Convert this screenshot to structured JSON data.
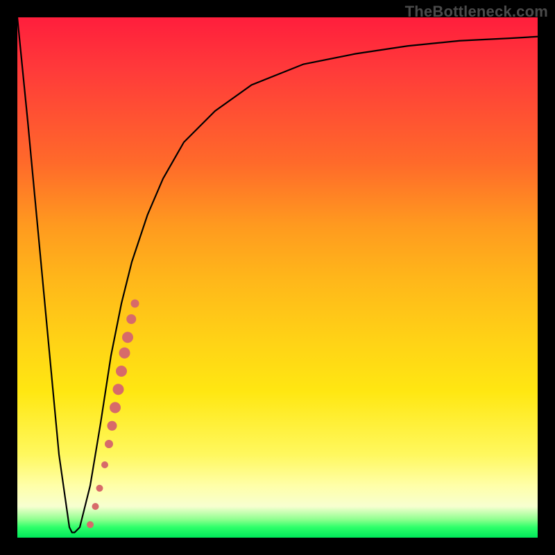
{
  "watermark": {
    "text": "TheBottleneck.com"
  },
  "chart_data": {
    "type": "line",
    "title": "",
    "xlabel": "",
    "ylabel": "",
    "xlim": [
      0,
      100
    ],
    "ylim": [
      0,
      100
    ],
    "series": [
      {
        "name": "bottleneck-curve",
        "x": [
          0,
          2,
          5,
          8,
          10,
          10.5,
          11,
          12,
          14,
          16,
          18,
          20,
          22,
          25,
          28,
          32,
          38,
          45,
          55,
          65,
          75,
          85,
          95,
          100
        ],
        "values": [
          100,
          80,
          48,
          16,
          2,
          1,
          1,
          2,
          10,
          22,
          35,
          45,
          53,
          62,
          69,
          76,
          82,
          87,
          91,
          93,
          94.5,
          95.5,
          96,
          96.3
        ]
      }
    ],
    "markers": [
      {
        "name": "highlight-segment",
        "color": "#d76a6a",
        "points": [
          {
            "x": 14.0,
            "y": 2.5,
            "r": 5
          },
          {
            "x": 15.0,
            "y": 6.0,
            "r": 5
          },
          {
            "x": 15.8,
            "y": 9.5,
            "r": 5
          },
          {
            "x": 16.8,
            "y": 14.0,
            "r": 5
          },
          {
            "x": 17.6,
            "y": 18.0,
            "r": 6
          },
          {
            "x": 18.2,
            "y": 21.5,
            "r": 7
          },
          {
            "x": 18.8,
            "y": 25.0,
            "r": 8
          },
          {
            "x": 19.4,
            "y": 28.5,
            "r": 8
          },
          {
            "x": 20.0,
            "y": 32.0,
            "r": 8
          },
          {
            "x": 20.6,
            "y": 35.5,
            "r": 8
          },
          {
            "x": 21.2,
            "y": 38.5,
            "r": 8
          },
          {
            "x": 21.9,
            "y": 42.0,
            "r": 7
          },
          {
            "x": 22.6,
            "y": 45.0,
            "r": 6
          }
        ]
      }
    ],
    "background_gradient": {
      "top": "#ff1e3c",
      "mid": "#ffd216",
      "bottom": "#00e85a"
    }
  }
}
